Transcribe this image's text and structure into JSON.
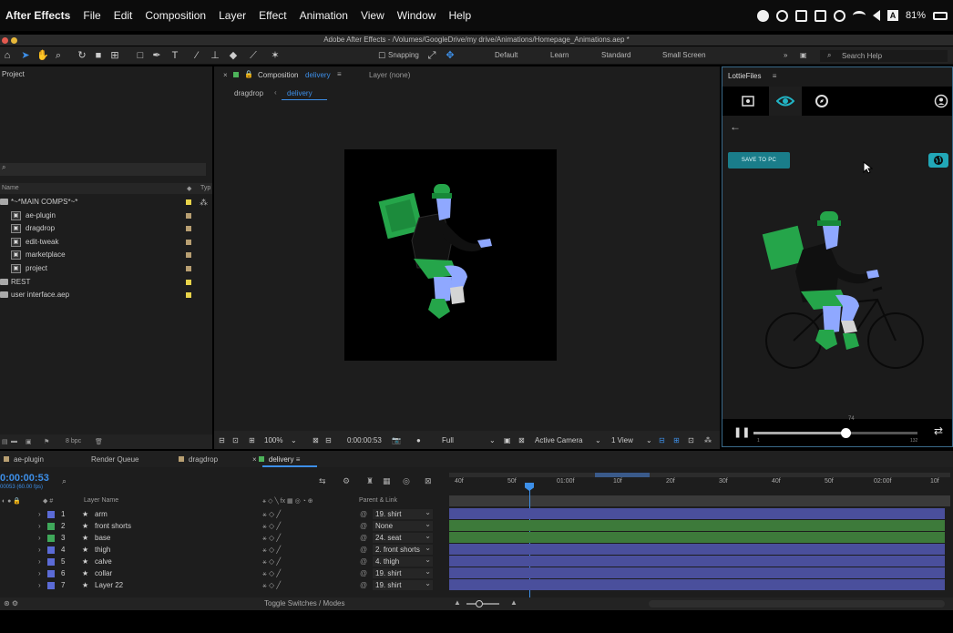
{
  "menubar": {
    "app": "After Effects",
    "items": [
      "File",
      "Edit",
      "Composition",
      "Layer",
      "Effect",
      "Animation",
      "View",
      "Window",
      "Help"
    ],
    "battery": "81%",
    "input_badge": "A"
  },
  "window": {
    "title": "Adobe After Effects - /Volumes/GoogleDrive/my drive/Animations/Homepage_Animations.aep *"
  },
  "toolbar": {
    "snapping": "Snapping",
    "workspaces": [
      "Default",
      "Learn",
      "Standard",
      "Small Screen"
    ],
    "search_placeholder": "Search Help"
  },
  "project": {
    "title": "Project",
    "col_name": "Name",
    "col_type": "Typ",
    "items": [
      {
        "label": "*~*MAIN COMPS*~*",
        "kind": "folder",
        "color": "#e8d34a"
      },
      {
        "label": "ae-plugin",
        "kind": "comp",
        "color": "#b89f72"
      },
      {
        "label": "dragdrop",
        "kind": "comp",
        "color": "#b89f72"
      },
      {
        "label": "edit-tweak",
        "kind": "comp",
        "color": "#b89f72"
      },
      {
        "label": "marketplace",
        "kind": "comp",
        "color": "#b89f72"
      },
      {
        "label": "project",
        "kind": "comp",
        "color": "#b89f72"
      },
      {
        "label": "REST",
        "kind": "folder",
        "color": "#e8d34a"
      },
      {
        "label": "user interface.aep",
        "kind": "folder",
        "color": "#e8d34a"
      }
    ],
    "bpc": "8 bpc"
  },
  "composition": {
    "tab_prefix": "Composition",
    "tab_name": "delivery",
    "layer_tab": "Layer (none)",
    "crumbs": [
      "dragdrop",
      "delivery"
    ],
    "zoom": "100%",
    "timecode": "0:00:00:53",
    "resolution": "Full",
    "camera": "Active Camera",
    "views": "1 View"
  },
  "lottie": {
    "title": "LottieFiles",
    "save_label": "SAVE TO PC",
    "frame_top": "74",
    "frame_start": "1",
    "frame_end": "132",
    "progress": 0.56
  },
  "timeline": {
    "tabs": [
      {
        "label": "ae-plugin",
        "color": "#b89f72"
      },
      {
        "label": "Render Queue",
        "color": ""
      },
      {
        "label": "dragdrop",
        "color": "#b89f72"
      },
      {
        "label": "delivery",
        "color": "#4db35a"
      }
    ],
    "timecode": "0:00:00:53",
    "fps": "00053 (60.00 fps)",
    "col_layer": "Layer Name",
    "col_parent": "Parent & Link",
    "ruler": [
      "40f",
      "50f",
      "01:00f",
      "10f",
      "20f",
      "30f",
      "40f",
      "50f",
      "02:00f",
      "10f"
    ],
    "layers": [
      {
        "num": "1",
        "name": "arm",
        "parent": "19. shirt",
        "color": "#5b6bd6",
        "bar": "#4a4f9c"
      },
      {
        "num": "2",
        "name": "front shorts",
        "parent": "None",
        "color": "#3fa85a",
        "bar": "#3d7a3a"
      },
      {
        "num": "3",
        "name": "base",
        "parent": "24. seat",
        "color": "#3fa85a",
        "bar": "#3d7a3a"
      },
      {
        "num": "4",
        "name": "thigh",
        "parent": "2. front shorts",
        "color": "#5b6bd6",
        "bar": "#4a4f9c"
      },
      {
        "num": "5",
        "name": "calve",
        "parent": "4. thigh",
        "color": "#5b6bd6",
        "bar": "#4a4f9c"
      },
      {
        "num": "6",
        "name": "collar",
        "parent": "19. shirt",
        "color": "#5b6bd6",
        "bar": "#4a4f9c"
      },
      {
        "num": "7",
        "name": "Layer 22",
        "parent": "19. shirt",
        "color": "#5b6bd6",
        "bar": "#4a4f9c"
      }
    ],
    "footer": "Toggle Switches / Modes"
  }
}
